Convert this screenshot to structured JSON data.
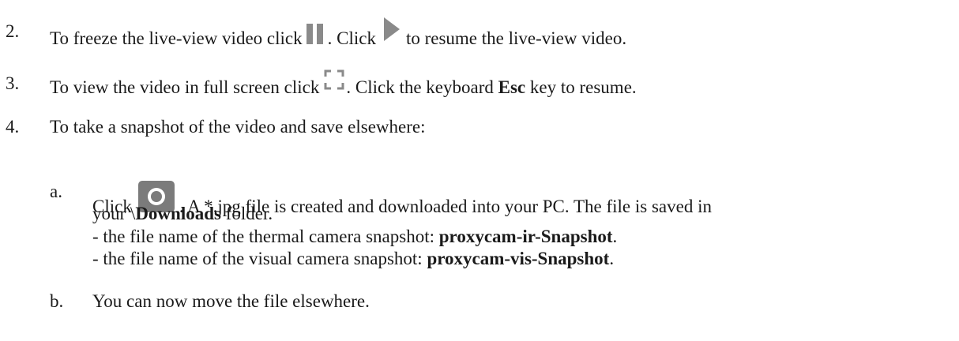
{
  "items": [
    {
      "number": "2.",
      "text_1": "To freeze the live-view video click",
      "icon_1": "pause-icon",
      "text_2": ". Click",
      "icon_2": "play-icon",
      "text_3": "to resume the live-view video."
    },
    {
      "number": "3.",
      "text_1": "To view the video in full screen click",
      "icon_1": "fullscreen-icon",
      "text_2": ". Click the keyboard",
      "bold_1": "Esc",
      "text_3": "key to resume."
    },
    {
      "number": "4.",
      "text_1": "To take a snapshot of the video and save elsewhere:"
    }
  ],
  "subitems": [
    {
      "letter": "a.",
      "text_1": "Click",
      "icon_1": "camera-icon",
      "text_2": ". A *.jpg file is created and downloaded into your PC. The file is saved in",
      "text_3": "your \\",
      "bold_1": "Downloads",
      "text_4": "folder.",
      "line_ir_prefix": "- the file name of the thermal camera snapshot:",
      "line_ir_bold": "proxycam-ir-Snapshot",
      "line_ir_suffix": ".",
      "line_vis_prefix": "- the file name of the visual camera snapshot:",
      "line_vis_bold": "proxycam-vis-Snapshot",
      "line_vis_suffix": "."
    },
    {
      "letter": "b.",
      "text_1": "You can now move the file elsewhere."
    }
  ],
  "colors": {
    "text": "#1a1a1a",
    "icon_gray": "#8a8a8a",
    "camera_gray": "#7b7b7b"
  }
}
